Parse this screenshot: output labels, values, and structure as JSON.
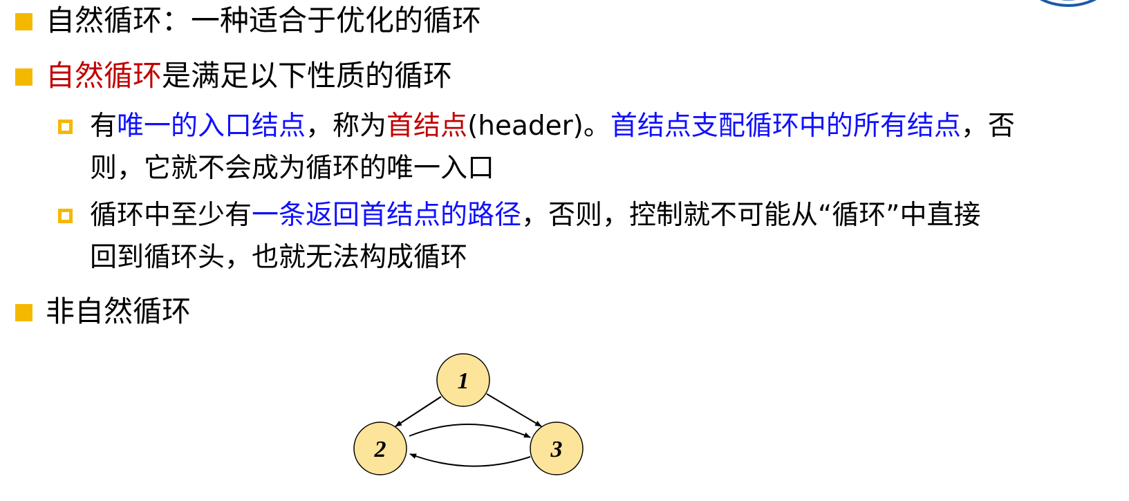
{
  "theme": {
    "bullet_color": "#f5b800",
    "red_highlight": "#c00000",
    "blue_highlight": "#1010ff",
    "node_fill": "#fce49a"
  },
  "bullets": [
    {
      "text": "自然循环：一种适合于优化的循环"
    },
    {
      "red": "自然循环",
      "rest": "是满足以下性质的循环"
    },
    {
      "text": "非自然循环"
    }
  ],
  "sub_items": [
    {
      "line1": {
        "p1": "有",
        "p2": "唯一的入口结点",
        "p3": "，称为",
        "p4": "首结点",
        "p5": "(header)。",
        "p6": "首结点支配循环中的所有结点",
        "p7": "，否"
      },
      "line2": "则，它就不会成为循环的唯一入口"
    },
    {
      "line1": {
        "p1": "循环中至少有",
        "p2": "一条返回首结点的路径",
        "p3": "，否则，控制就不可能从“循环”中直接"
      },
      "line2": "回到循环头，也就无法构成循环"
    }
  ],
  "graph": {
    "nodes": [
      "1",
      "2",
      "3"
    ],
    "edges": [
      {
        "from": "1",
        "to": "2"
      },
      {
        "from": "1",
        "to": "3"
      },
      {
        "from": "2",
        "to": "3"
      },
      {
        "from": "3",
        "to": "2"
      }
    ]
  }
}
